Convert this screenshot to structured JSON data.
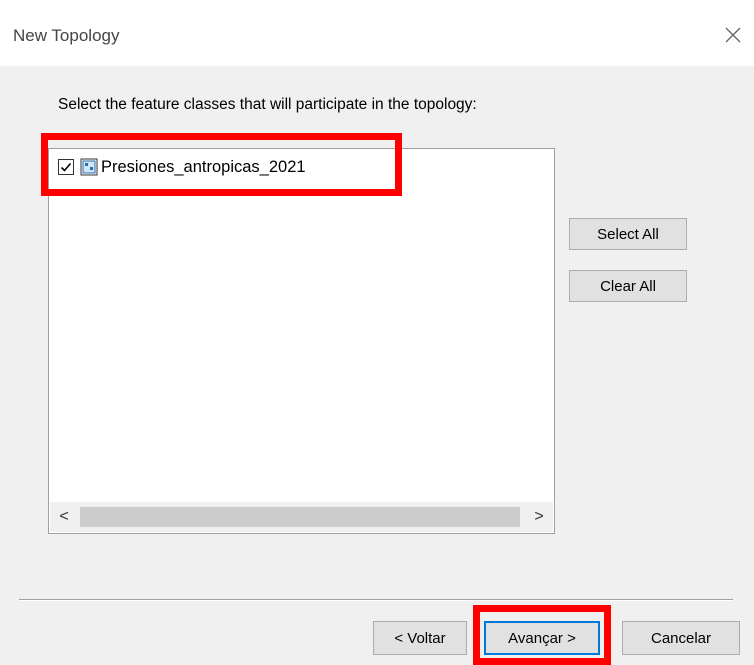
{
  "window": {
    "title": "New Topology",
    "close_icon": "close-icon"
  },
  "prompt": "Select the feature classes that will participate in the topology:",
  "feature_classes": [
    {
      "label": "Presiones_antropicas_2021",
      "checked": true,
      "icon": "feature-class-icon"
    }
  ],
  "scrollbar": {
    "left_arrow": "<",
    "right_arrow": ">"
  },
  "side_buttons": {
    "select_all": "Select All",
    "clear_all": "Clear All"
  },
  "footer_buttons": {
    "back": "< Voltar",
    "next": "Avançar >",
    "cancel": "Cancelar"
  },
  "colors": {
    "annotation": "#ff0000",
    "dialog_bg": "#f0f0f0",
    "button_bg": "#e1e1e1",
    "default_button_border": "#0078d7"
  }
}
